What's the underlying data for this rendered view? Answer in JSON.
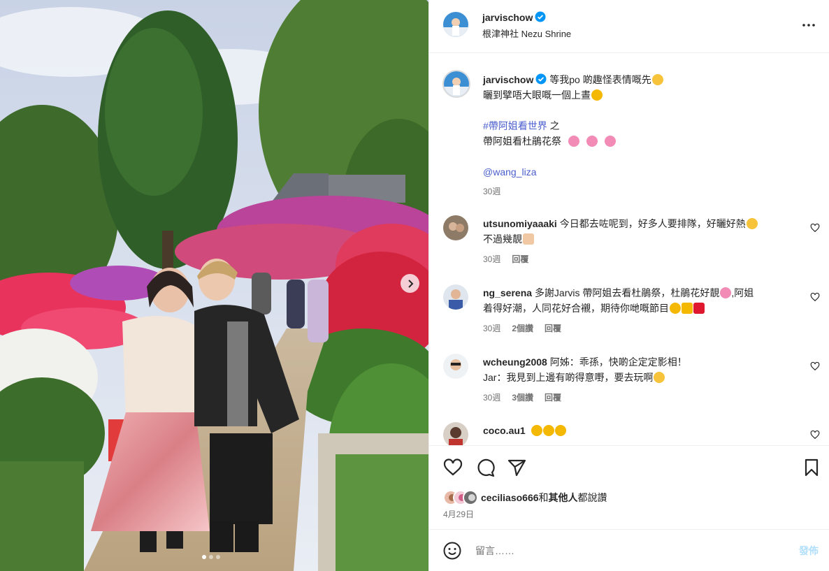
{
  "post": {
    "author": "jarvischow",
    "location": "根津神社 Nezu Shrine",
    "photo_indicator": {
      "count": 3,
      "active": 0
    }
  },
  "caption": {
    "author": "jarvischow",
    "line1": "等我po 啲趣怪表情嘅先",
    "line2": "曬到擘唔大眼嘅一個上晝",
    "hashtag": "#帶阿姐看世界",
    "hashtag_suffix": " 之",
    "line4": "帶阿姐看杜鵑花祭",
    "mention": "@wang_liza",
    "time": "30週"
  },
  "comments": [
    {
      "user": "utsunomiyaaaki",
      "text1": "今日都去咗呢到，好多人要排隊，好曬好熱",
      "text2": "不過幾靚",
      "time": "30週",
      "likes": "",
      "reply": "回覆"
    },
    {
      "user": "ng_serena",
      "text1": "多謝Jarvis 帶阿姐去看杜鵑祭，杜鵑花好靚",
      "text1b": ",阿姐",
      "text2": "着得好潮，人同花好合襯，期待你哋嘅節目",
      "time": "30週",
      "likes": "2個讚",
      "reply": "回覆"
    },
    {
      "user": "wcheung2008",
      "text1": "阿姊：乖孫，快啲企定定影相！",
      "text2": "Jar：我見到上邊有啲得意嘢，要去玩啊",
      "time": "30週",
      "likes": "3個讚",
      "reply": "回覆"
    },
    {
      "user": "coco.au1",
      "text1": "",
      "text2": "",
      "time": "",
      "likes": "",
      "reply": ""
    }
  ],
  "likes": {
    "user": "ceciliaso666",
    "middle": "和",
    "others": "其他人",
    "suffix": "都說讚"
  },
  "date": "4月29日",
  "comment_box": {
    "placeholder": "留言……",
    "post_label": "發佈"
  },
  "photo_scene": {
    "count_label": ""
  },
  "colors": {
    "link": "#4a5ecd",
    "verified": "#0095f6",
    "post_disabled": "#b2dffc"
  }
}
